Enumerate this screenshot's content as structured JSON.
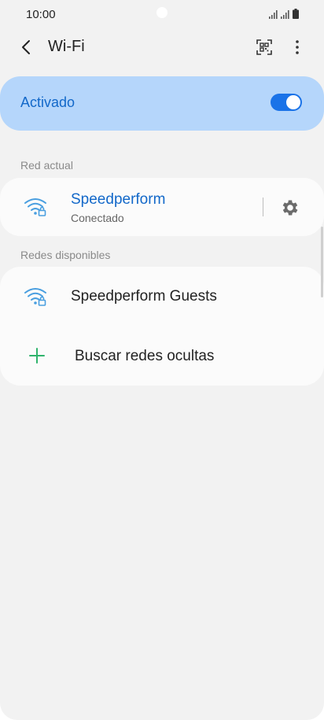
{
  "status_bar": {
    "time": "10:00"
  },
  "header": {
    "title": "Wi-Fi"
  },
  "toggle": {
    "label": "Activado",
    "state": "on"
  },
  "current": {
    "section_label": "Red actual",
    "network": {
      "name": "Speedperform",
      "status": "Conectado"
    }
  },
  "available": {
    "section_label": "Redes disponibles",
    "networks": [
      {
        "name": "Speedperform Guests"
      }
    ],
    "add_hidden_label": "Buscar redes ocultas"
  },
  "colors": {
    "accent": "#1a73e8",
    "connected_text": "#1268c9",
    "plus_green": "#2fb36c",
    "wifi_icon": "#4a9fe0"
  },
  "icons": [
    "back-arrow-icon",
    "qr-code-icon",
    "more-vertical-icon",
    "wifi-lock-icon",
    "settings-gear-icon",
    "plus-icon",
    "signal-icon",
    "battery-icon"
  ]
}
